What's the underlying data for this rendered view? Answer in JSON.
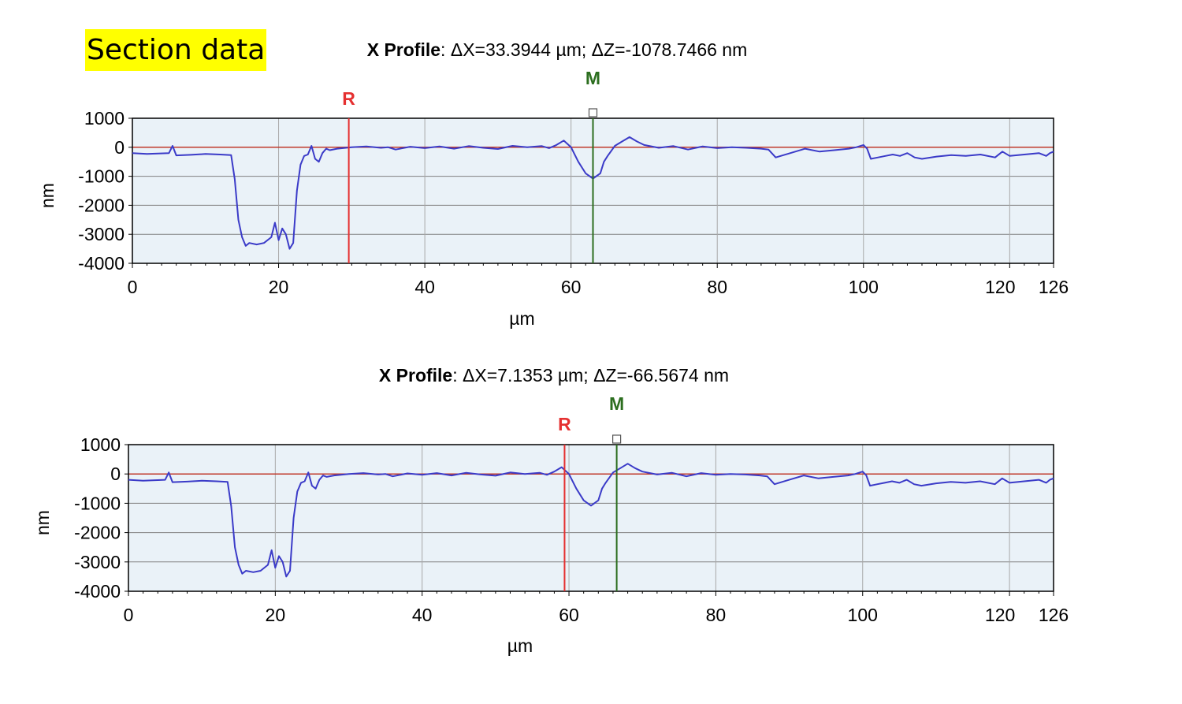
{
  "page": {
    "title": "Section data"
  },
  "colors": {
    "reference": "#e53030",
    "measure": "#2c6e1f",
    "trace": "#3b3bc8",
    "zero_line": "#c0392b",
    "plot_bg": "#eaf2f8",
    "grid": "#808080"
  },
  "chart_data": [
    {
      "type": "line",
      "title_bold": "X Profile",
      "title_rest": ": ΔX=33.3944 µm; ΔZ=-1078.7466 nm",
      "xlabel": "µm",
      "ylabel": "nm",
      "xlim": [
        0,
        126
      ],
      "ylim": [
        -4000,
        1000
      ],
      "xticks": [
        0,
        20,
        40,
        60,
        80,
        100,
        120,
        126
      ],
      "yticks": [
        1000,
        0,
        -1000,
        -2000,
        -3000,
        -4000
      ],
      "grid": true,
      "cursors": [
        {
          "label": "R",
          "x": 29.6,
          "color": "#e53030"
        },
        {
          "label": "M",
          "x": 63.0,
          "color": "#2c6e1f"
        }
      ],
      "series": [
        {
          "x": [
            0,
            2,
            5,
            5.5,
            6,
            8,
            10,
            12,
            13.5,
            14,
            14.5,
            15,
            15.5,
            16,
            17,
            18,
            19,
            19.5,
            20,
            20.5,
            21,
            21.5,
            22,
            22.5,
            23,
            23.5,
            24,
            24.5,
            25,
            25.5,
            26,
            26.5,
            27,
            28,
            30,
            32,
            34,
            35,
            36,
            38,
            40,
            42,
            44,
            46,
            48,
            50,
            52,
            54,
            56,
            57,
            58,
            59,
            60,
            61,
            62,
            63,
            64,
            64.5,
            65,
            66,
            67,
            68,
            69,
            70,
            72,
            74,
            76,
            78,
            80,
            82,
            84,
            86,
            87,
            88,
            90,
            92,
            94,
            96,
            98,
            99,
            100,
            100.5,
            101,
            102,
            103,
            104,
            105,
            106,
            107,
            108,
            110,
            112,
            114,
            116,
            118,
            119,
            120,
            122,
            124,
            125,
            125.5,
            126
          ],
          "y": [
            -200,
            -230,
            -200,
            50,
            -280,
            -260,
            -230,
            -250,
            -270,
            -1100,
            -2500,
            -3100,
            -3400,
            -3300,
            -3350,
            -3300,
            -3100,
            -2600,
            -3200,
            -2800,
            -3000,
            -3500,
            -3300,
            -1500,
            -600,
            -300,
            -250,
            50,
            -400,
            -500,
            -200,
            -50,
            -100,
            -50,
            0,
            30,
            -20,
            0,
            -80,
            20,
            -30,
            30,
            -50,
            40,
            -20,
            -60,
            50,
            0,
            40,
            -30,
            80,
            230,
            0,
            -500,
            -900,
            -1080,
            -900,
            -500,
            -300,
            50,
            200,
            350,
            200,
            80,
            -20,
            40,
            -80,
            30,
            -30,
            0,
            -20,
            -50,
            -80,
            -350,
            -200,
            -50,
            -150,
            -100,
            -50,
            0,
            80,
            -50,
            -400,
            -350,
            -300,
            -250,
            -300,
            -200,
            -350,
            -400,
            -320,
            -270,
            -300,
            -250,
            -350,
            -150,
            -300,
            -250,
            -200,
            -300,
            -200,
            -150
          ]
        }
      ]
    },
    {
      "type": "line",
      "title_bold": "X Profile",
      "title_rest": ": ΔX=7.1353 µm; ΔZ=-66.5674 nm",
      "xlabel": "µm",
      "ylabel": "nm",
      "xlim": [
        0,
        126
      ],
      "ylim": [
        -4000,
        1000
      ],
      "xticks": [
        0,
        20,
        40,
        60,
        80,
        100,
        120,
        126
      ],
      "yticks": [
        1000,
        0,
        -1000,
        -2000,
        -3000,
        -4000
      ],
      "grid": true,
      "cursors": [
        {
          "label": "R",
          "x": 59.4,
          "color": "#e53030"
        },
        {
          "label": "M",
          "x": 66.5,
          "color": "#2c6e1f"
        }
      ],
      "series": [
        {
          "x": [
            0,
            2,
            5,
            5.5,
            6,
            8,
            10,
            12,
            13.5,
            14,
            14.5,
            15,
            15.5,
            16,
            17,
            18,
            19,
            19.5,
            20,
            20.5,
            21,
            21.5,
            22,
            22.5,
            23,
            23.5,
            24,
            24.5,
            25,
            25.5,
            26,
            26.5,
            27,
            28,
            30,
            32,
            34,
            35,
            36,
            38,
            40,
            42,
            44,
            46,
            48,
            50,
            52,
            54,
            56,
            57,
            58,
            59,
            60,
            61,
            62,
            63,
            64,
            64.5,
            65,
            66,
            67,
            68,
            69,
            70,
            72,
            74,
            76,
            78,
            80,
            82,
            84,
            86,
            87,
            88,
            90,
            92,
            94,
            96,
            98,
            99,
            100,
            100.5,
            101,
            102,
            103,
            104,
            105,
            106,
            107,
            108,
            110,
            112,
            114,
            116,
            118,
            119,
            120,
            122,
            124,
            125,
            125.5,
            126
          ],
          "y": [
            -200,
            -230,
            -200,
            50,
            -280,
            -260,
            -230,
            -250,
            -270,
            -1100,
            -2500,
            -3100,
            -3400,
            -3300,
            -3350,
            -3300,
            -3100,
            -2600,
            -3200,
            -2800,
            -3000,
            -3500,
            -3300,
            -1500,
            -600,
            -300,
            -250,
            50,
            -400,
            -500,
            -200,
            -50,
            -100,
            -50,
            0,
            30,
            -20,
            0,
            -80,
            20,
            -30,
            30,
            -50,
            40,
            -20,
            -60,
            50,
            0,
            40,
            -30,
            80,
            230,
            0,
            -500,
            -900,
            -1080,
            -900,
            -500,
            -300,
            50,
            200,
            350,
            200,
            80,
            -20,
            40,
            -80,
            30,
            -30,
            0,
            -20,
            -50,
            -80,
            -350,
            -200,
            -50,
            -150,
            -100,
            -50,
            0,
            80,
            -50,
            -400,
            -350,
            -300,
            -250,
            -300,
            -200,
            -350,
            -400,
            -320,
            -270,
            -300,
            -250,
            -350,
            -150,
            -300,
            -250,
            -200,
            -300,
            -200,
            -150
          ]
        }
      ]
    }
  ]
}
